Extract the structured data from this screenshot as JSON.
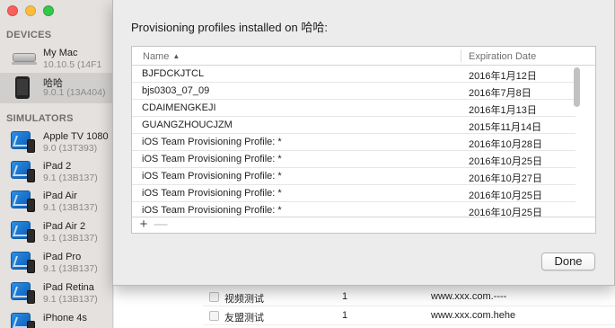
{
  "sidebar": {
    "devices_title": "DEVICES",
    "simulators_title": "SIMULATORS",
    "devices": [
      {
        "name": "My Mac",
        "sub": "10.10.5 (14F1",
        "icon": "mac-icon"
      },
      {
        "name": "哈哈",
        "sub": "9.0.1 (13A404)",
        "icon": "iphone-icon",
        "selected": true
      }
    ],
    "simulators": [
      {
        "name": "Apple TV 1080",
        "sub": "9.0 (13T393)"
      },
      {
        "name": "iPad 2",
        "sub": "9.1 (13B137)"
      },
      {
        "name": "iPad Air",
        "sub": "9.1 (13B137)"
      },
      {
        "name": "iPad Air 2",
        "sub": "9.1 (13B137)"
      },
      {
        "name": "iPad Pro",
        "sub": "9.1 (13B137)"
      },
      {
        "name": "iPad Retina",
        "sub": "9.1 (13B137)"
      },
      {
        "name": "iPhone 4s",
        "sub": ""
      }
    ]
  },
  "sheet": {
    "title": "Provisioning profiles installed on 哈哈:",
    "columns": {
      "name": "Name",
      "expiration": "Expiration Date"
    },
    "rows": [
      {
        "name": "BJFDCKJTCL",
        "expiration": "2016年1月12日"
      },
      {
        "name": "bjs0303_07_09",
        "expiration": "2016年7月8日"
      },
      {
        "name": "CDAIMENGKEJI",
        "expiration": "2016年1月13日"
      },
      {
        "name": "GUANGZHOUCJZM",
        "expiration": "2015年11月14日"
      },
      {
        "name": "iOS Team Provisioning Profile: *",
        "expiration": "2016年10月28日"
      },
      {
        "name": "iOS Team Provisioning Profile: *",
        "expiration": "2016年10月25日"
      },
      {
        "name": "iOS Team Provisioning Profile: *",
        "expiration": "2016年10月27日"
      },
      {
        "name": "iOS Team Provisioning Profile: *",
        "expiration": "2016年10月25日"
      },
      {
        "name": "iOS Team Provisioning Profile: *",
        "expiration": "2016年10月25日"
      }
    ],
    "add_label": "+",
    "remove_label": "—",
    "done_label": "Done"
  },
  "background_table": {
    "rows": [
      {
        "name": "视频测试",
        "count": "1",
        "url": "www.xxx.com.----"
      },
      {
        "name": "友盟测试",
        "count": "1",
        "url": "www.xxx.com.hehe"
      }
    ]
  }
}
